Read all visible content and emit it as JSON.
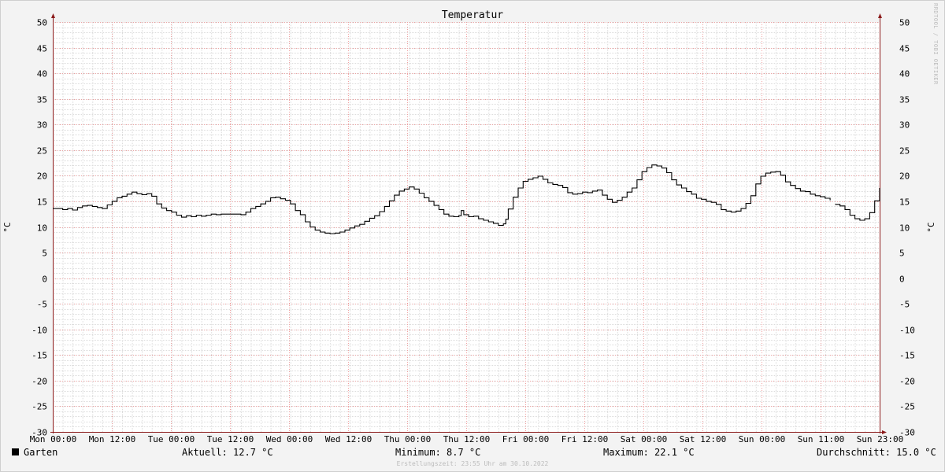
{
  "chart_data": {
    "type": "line",
    "title": "Temperatur",
    "ylabel": "°C",
    "ylim": [
      -30,
      50
    ],
    "yticks": [
      50,
      45,
      40,
      35,
      30,
      25,
      20,
      15,
      10,
      5,
      0,
      -5,
      -10,
      -15,
      -20,
      -25,
      -30
    ],
    "xtick_labels": [
      "Mon 00:00",
      "Mon 12:00",
      "Tue 00:00",
      "Tue 12:00",
      "Wed 00:00",
      "Wed 12:00",
      "Thu 00:00",
      "Thu 12:00",
      "Fri 00:00",
      "Fri 12:00",
      "Sat 00:00",
      "Sat 12:00",
      "Sun 00:00",
      "Sun 11:00",
      "Sun 23:00"
    ],
    "x_unit": "hours since Mon 00:00",
    "xlim": [
      0,
      167
    ],
    "grid": true,
    "legend_position": "bottom-left",
    "series": [
      {
        "name": "Garten",
        "color": "#000000",
        "segments": [
          [
            [
              0,
              13.6
            ],
            [
              2,
              13.4
            ],
            [
              3,
              13.6
            ],
            [
              4,
              13.3
            ],
            [
              5,
              13.8
            ],
            [
              6,
              14.1
            ],
            [
              7,
              14.2
            ],
            [
              8,
              14.0
            ],
            [
              9,
              13.8
            ],
            [
              10,
              13.6
            ],
            [
              11,
              14.3
            ],
            [
              12,
              15.0
            ],
            [
              13,
              15.7
            ],
            [
              14,
              16.0
            ],
            [
              15,
              16.4
            ],
            [
              16,
              16.8
            ],
            [
              17,
              16.5
            ],
            [
              18,
              16.3
            ],
            [
              19,
              16.5
            ],
            [
              20,
              16.0
            ],
            [
              21,
              14.5
            ],
            [
              22,
              13.7
            ],
            [
              23,
              13.2
            ],
            [
              24,
              12.9
            ],
            [
              25,
              12.3
            ],
            [
              26,
              11.9
            ],
            [
              27,
              12.2
            ],
            [
              28,
              12.0
            ],
            [
              29,
              12.3
            ],
            [
              30,
              12.1
            ],
            [
              31,
              12.3
            ],
            [
              32,
              12.5
            ],
            [
              33,
              12.4
            ],
            [
              34,
              12.5
            ],
            [
              36,
              12.5
            ],
            [
              38,
              12.4
            ],
            [
              39,
              12.9
            ],
            [
              40,
              13.6
            ],
            [
              41,
              14.0
            ],
            [
              42,
              14.5
            ],
            [
              43,
              15.0
            ],
            [
              44,
              15.7
            ],
            [
              45,
              15.8
            ],
            [
              46,
              15.5
            ],
            [
              47,
              15.2
            ],
            [
              48,
              14.5
            ],
            [
              49,
              13.2
            ],
            [
              50,
              12.4
            ],
            [
              51,
              11.0
            ],
            [
              52,
              10.0
            ],
            [
              53,
              9.4
            ],
            [
              54,
              9.0
            ],
            [
              55,
              8.8
            ],
            [
              56,
              8.7
            ],
            [
              57,
              8.8
            ],
            [
              58,
              9.0
            ],
            [
              59,
              9.4
            ],
            [
              60,
              9.8
            ],
            [
              61,
              10.2
            ],
            [
              62,
              10.5
            ],
            [
              63,
              11.1
            ],
            [
              64,
              11.7
            ],
            [
              65,
              12.2
            ],
            [
              66,
              13.0
            ],
            [
              67,
              14.0
            ],
            [
              68,
              15.1
            ],
            [
              69,
              16.2
            ],
            [
              70,
              17.0
            ],
            [
              71,
              17.4
            ],
            [
              72,
              17.8
            ],
            [
              73,
              17.4
            ],
            [
              74,
              16.6
            ],
            [
              75,
              15.7
            ],
            [
              76,
              15.0
            ],
            [
              77,
              14.2
            ],
            [
              78,
              13.4
            ],
            [
              79,
              12.5
            ],
            [
              80,
              12.1
            ],
            [
              81,
              12.0
            ],
            [
              82,
              12.2
            ],
            [
              82.5,
              13.2
            ],
            [
              83,
              12.4
            ],
            [
              84,
              12.0
            ],
            [
              85,
              12.1
            ],
            [
              86,
              11.6
            ],
            [
              87,
              11.3
            ],
            [
              88,
              11.0
            ],
            [
              89,
              10.7
            ],
            [
              90,
              10.3
            ],
            [
              91,
              10.6
            ],
            [
              91.5,
              11.5
            ],
            [
              92,
              13.5
            ],
            [
              93,
              15.8
            ],
            [
              94,
              17.6
            ],
            [
              95,
              18.9
            ],
            [
              96,
              19.3
            ],
            [
              97,
              19.6
            ],
            [
              98,
              19.9
            ],
            [
              99,
              19.3
            ],
            [
              100,
              18.6
            ],
            [
              101,
              18.3
            ],
            [
              102,
              18.1
            ],
            [
              103,
              17.7
            ],
            [
              104,
              16.7
            ],
            [
              105,
              16.4
            ],
            [
              106,
              16.5
            ],
            [
              107,
              16.8
            ],
            [
              108,
              16.7
            ],
            [
              109,
              17.0
            ],
            [
              110,
              17.2
            ],
            [
              111,
              16.2
            ],
            [
              112,
              15.4
            ],
            [
              113,
              14.8
            ],
            [
              114,
              15.2
            ],
            [
              115,
              15.8
            ],
            [
              116,
              16.8
            ],
            [
              117,
              17.6
            ],
            [
              118,
              19.2
            ],
            [
              119,
              20.8
            ],
            [
              120,
              21.6
            ],
            [
              121,
              22.1
            ],
            [
              122,
              21.9
            ],
            [
              123,
              21.5
            ],
            [
              124,
              20.6
            ],
            [
              125,
              19.2
            ],
            [
              126,
              18.2
            ],
            [
              127,
              17.6
            ],
            [
              128,
              16.9
            ],
            [
              129,
              16.4
            ],
            [
              130,
              15.6
            ],
            [
              131,
              15.4
            ],
            [
              132,
              15.0
            ],
            [
              133,
              14.8
            ],
            [
              134,
              14.4
            ],
            [
              135,
              13.4
            ],
            [
              136,
              13.1
            ],
            [
              137,
              12.9
            ],
            [
              138,
              13.1
            ],
            [
              139,
              13.6
            ],
            [
              140,
              14.6
            ],
            [
              141,
              16.1
            ],
            [
              142,
              18.4
            ],
            [
              143,
              19.9
            ],
            [
              144,
              20.5
            ],
            [
              145,
              20.7
            ],
            [
              146,
              20.8
            ],
            [
              147,
              20.1
            ],
            [
              148,
              18.8
            ],
            [
              149,
              18.1
            ],
            [
              150,
              17.5
            ],
            [
              151,
              17.0
            ],
            [
              152,
              16.9
            ],
            [
              153,
              16.4
            ],
            [
              154,
              16.1
            ],
            [
              155,
              15.9
            ],
            [
              156,
              15.6
            ],
            [
              157,
              15.2
            ]
          ],
          [
            [
              158,
              14.4
            ],
            [
              159,
              14.1
            ],
            [
              160,
              13.4
            ],
            [
              161,
              12.3
            ],
            [
              162,
              11.6
            ],
            [
              163,
              11.3
            ],
            [
              164,
              11.6
            ],
            [
              165,
              12.8
            ],
            [
              166,
              15.1
            ],
            [
              167,
              17.6
            ]
          ]
        ]
      }
    ],
    "stats": [
      {
        "label": "Aktuell:",
        "value": "12.7 °C"
      },
      {
        "label": "Minimum:",
        "value": "8.7 °C"
      },
      {
        "label": "Maximum:",
        "value": "22.1 °C"
      },
      {
        "label": "Durchschnitt:",
        "value": "15.0 °C"
      }
    ]
  },
  "legend": {
    "series_label": "Garten"
  },
  "watermark": "RRDTOOL / TOBI OETIKER",
  "footer": "Erstellungszeit: 23:55 Uhr am 30.10.2022"
}
